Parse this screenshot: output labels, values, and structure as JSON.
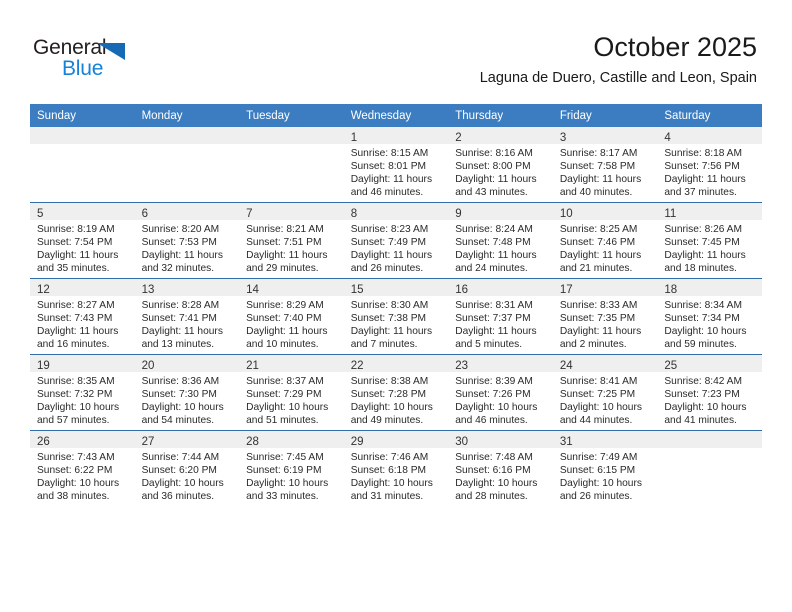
{
  "brand": {
    "name_dark": "General",
    "name_light": "Blue",
    "triangle_color": "#1669b5",
    "blue_color": "#1683d8"
  },
  "header": {
    "month_title": "October 2025",
    "location": "Laguna de Duero, Castille and Leon, Spain"
  },
  "theme": {
    "header_row_bg": "#3b7dc0",
    "daynum_band_bg": "#efefef",
    "grid_line": "#2f6ca8",
    "text": "#2a2a2a"
  },
  "calendar": {
    "weekday_headers": [
      "Sunday",
      "Monday",
      "Tuesday",
      "Wednesday",
      "Thursday",
      "Friday",
      "Saturday"
    ],
    "weeks": [
      [
        {
          "day": "",
          "empty": true
        },
        {
          "day": "",
          "empty": true
        },
        {
          "day": "",
          "empty": true
        },
        {
          "day": "1",
          "sunrise": "Sunrise: 8:15 AM",
          "sunset": "Sunset: 8:01 PM",
          "daylight1": "Daylight: 11 hours",
          "daylight2": "and 46 minutes."
        },
        {
          "day": "2",
          "sunrise": "Sunrise: 8:16 AM",
          "sunset": "Sunset: 8:00 PM",
          "daylight1": "Daylight: 11 hours",
          "daylight2": "and 43 minutes."
        },
        {
          "day": "3",
          "sunrise": "Sunrise: 8:17 AM",
          "sunset": "Sunset: 7:58 PM",
          "daylight1": "Daylight: 11 hours",
          "daylight2": "and 40 minutes."
        },
        {
          "day": "4",
          "sunrise": "Sunrise: 8:18 AM",
          "sunset": "Sunset: 7:56 PM",
          "daylight1": "Daylight: 11 hours",
          "daylight2": "and 37 minutes."
        }
      ],
      [
        {
          "day": "5",
          "sunrise": "Sunrise: 8:19 AM",
          "sunset": "Sunset: 7:54 PM",
          "daylight1": "Daylight: 11 hours",
          "daylight2": "and 35 minutes."
        },
        {
          "day": "6",
          "sunrise": "Sunrise: 8:20 AM",
          "sunset": "Sunset: 7:53 PM",
          "daylight1": "Daylight: 11 hours",
          "daylight2": "and 32 minutes."
        },
        {
          "day": "7",
          "sunrise": "Sunrise: 8:21 AM",
          "sunset": "Sunset: 7:51 PM",
          "daylight1": "Daylight: 11 hours",
          "daylight2": "and 29 minutes."
        },
        {
          "day": "8",
          "sunrise": "Sunrise: 8:23 AM",
          "sunset": "Sunset: 7:49 PM",
          "daylight1": "Daylight: 11 hours",
          "daylight2": "and 26 minutes."
        },
        {
          "day": "9",
          "sunrise": "Sunrise: 8:24 AM",
          "sunset": "Sunset: 7:48 PM",
          "daylight1": "Daylight: 11 hours",
          "daylight2": "and 24 minutes."
        },
        {
          "day": "10",
          "sunrise": "Sunrise: 8:25 AM",
          "sunset": "Sunset: 7:46 PM",
          "daylight1": "Daylight: 11 hours",
          "daylight2": "and 21 minutes."
        },
        {
          "day": "11",
          "sunrise": "Sunrise: 8:26 AM",
          "sunset": "Sunset: 7:45 PM",
          "daylight1": "Daylight: 11 hours",
          "daylight2": "and 18 minutes."
        }
      ],
      [
        {
          "day": "12",
          "sunrise": "Sunrise: 8:27 AM",
          "sunset": "Sunset: 7:43 PM",
          "daylight1": "Daylight: 11 hours",
          "daylight2": "and 16 minutes."
        },
        {
          "day": "13",
          "sunrise": "Sunrise: 8:28 AM",
          "sunset": "Sunset: 7:41 PM",
          "daylight1": "Daylight: 11 hours",
          "daylight2": "and 13 minutes."
        },
        {
          "day": "14",
          "sunrise": "Sunrise: 8:29 AM",
          "sunset": "Sunset: 7:40 PM",
          "daylight1": "Daylight: 11 hours",
          "daylight2": "and 10 minutes."
        },
        {
          "day": "15",
          "sunrise": "Sunrise: 8:30 AM",
          "sunset": "Sunset: 7:38 PM",
          "daylight1": "Daylight: 11 hours",
          "daylight2": "and 7 minutes."
        },
        {
          "day": "16",
          "sunrise": "Sunrise: 8:31 AM",
          "sunset": "Sunset: 7:37 PM",
          "daylight1": "Daylight: 11 hours",
          "daylight2": "and 5 minutes."
        },
        {
          "day": "17",
          "sunrise": "Sunrise: 8:33 AM",
          "sunset": "Sunset: 7:35 PM",
          "daylight1": "Daylight: 11 hours",
          "daylight2": "and 2 minutes."
        },
        {
          "day": "18",
          "sunrise": "Sunrise: 8:34 AM",
          "sunset": "Sunset: 7:34 PM",
          "daylight1": "Daylight: 10 hours",
          "daylight2": "and 59 minutes."
        }
      ],
      [
        {
          "day": "19",
          "sunrise": "Sunrise: 8:35 AM",
          "sunset": "Sunset: 7:32 PM",
          "daylight1": "Daylight: 10 hours",
          "daylight2": "and 57 minutes."
        },
        {
          "day": "20",
          "sunrise": "Sunrise: 8:36 AM",
          "sunset": "Sunset: 7:30 PM",
          "daylight1": "Daylight: 10 hours",
          "daylight2": "and 54 minutes."
        },
        {
          "day": "21",
          "sunrise": "Sunrise: 8:37 AM",
          "sunset": "Sunset: 7:29 PM",
          "daylight1": "Daylight: 10 hours",
          "daylight2": "and 51 minutes."
        },
        {
          "day": "22",
          "sunrise": "Sunrise: 8:38 AM",
          "sunset": "Sunset: 7:28 PM",
          "daylight1": "Daylight: 10 hours",
          "daylight2": "and 49 minutes."
        },
        {
          "day": "23",
          "sunrise": "Sunrise: 8:39 AM",
          "sunset": "Sunset: 7:26 PM",
          "daylight1": "Daylight: 10 hours",
          "daylight2": "and 46 minutes."
        },
        {
          "day": "24",
          "sunrise": "Sunrise: 8:41 AM",
          "sunset": "Sunset: 7:25 PM",
          "daylight1": "Daylight: 10 hours",
          "daylight2": "and 44 minutes."
        },
        {
          "day": "25",
          "sunrise": "Sunrise: 8:42 AM",
          "sunset": "Sunset: 7:23 PM",
          "daylight1": "Daylight: 10 hours",
          "daylight2": "and 41 minutes."
        }
      ],
      [
        {
          "day": "26",
          "sunrise": "Sunrise: 7:43 AM",
          "sunset": "Sunset: 6:22 PM",
          "daylight1": "Daylight: 10 hours",
          "daylight2": "and 38 minutes."
        },
        {
          "day": "27",
          "sunrise": "Sunrise: 7:44 AM",
          "sunset": "Sunset: 6:20 PM",
          "daylight1": "Daylight: 10 hours",
          "daylight2": "and 36 minutes."
        },
        {
          "day": "28",
          "sunrise": "Sunrise: 7:45 AM",
          "sunset": "Sunset: 6:19 PM",
          "daylight1": "Daylight: 10 hours",
          "daylight2": "and 33 minutes."
        },
        {
          "day": "29",
          "sunrise": "Sunrise: 7:46 AM",
          "sunset": "Sunset: 6:18 PM",
          "daylight1": "Daylight: 10 hours",
          "daylight2": "and 31 minutes."
        },
        {
          "day": "30",
          "sunrise": "Sunrise: 7:48 AM",
          "sunset": "Sunset: 6:16 PM",
          "daylight1": "Daylight: 10 hours",
          "daylight2": "and 28 minutes."
        },
        {
          "day": "31",
          "sunrise": "Sunrise: 7:49 AM",
          "sunset": "Sunset: 6:15 PM",
          "daylight1": "Daylight: 10 hours",
          "daylight2": "and 26 minutes."
        },
        {
          "day": "",
          "empty": true
        }
      ]
    ]
  }
}
